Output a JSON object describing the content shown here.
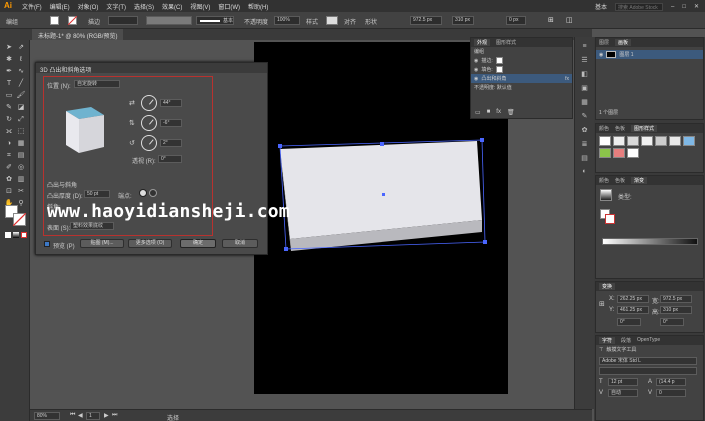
{
  "app": {
    "logo": "Ai"
  },
  "menubar": {
    "items": [
      "文件(F)",
      "编辑(E)",
      "对象(O)",
      "文字(T)",
      "选择(S)",
      "效果(C)",
      "视图(V)",
      "窗口(W)",
      "帮助(H)"
    ],
    "workspace": "基本",
    "search_placeholder": "搜索 Adobe Stock"
  },
  "control": {
    "label": "编组",
    "stroke_label": "描边",
    "style_label": "基本",
    "opacity_label": "不透明度",
    "opacity_value": "100%",
    "style2_label": "样式",
    "align_label": "对齐",
    "shape_label": "形状",
    "x_value": "972.5 px",
    "w_value": "310 px",
    "h_value": "0 px"
  },
  "document": {
    "tab": "未标题-1* @ 80% (RGB/预览)"
  },
  "dialog": {
    "title": "3D 凸出和斜角选项",
    "position_label": "位置 (N):",
    "position_value": "自定旋转",
    "x_angle": "44°",
    "y_angle": "-6°",
    "z_angle": "2°",
    "perspective_label": "透视 (R):",
    "perspective_value": "0°",
    "extrude_section": "凸出与斜角",
    "extrude_depth_label": "凸出厚度 (D):",
    "extrude_depth_value": "50 pt",
    "cap_label": "端点:",
    "bevel_label": "斜角:",
    "surface_label": "表面 (S):",
    "surface_value": "塑料效果底纹",
    "preview_label": "预览 (P)",
    "map_button": "贴图 (M)...",
    "more_button": "更多选项 (O)",
    "ok_button": "确定",
    "cancel_button": "取消"
  },
  "appearance": {
    "tabs": [
      "外观",
      "图形样式"
    ],
    "title": "编组",
    "rows": [
      "描边:",
      "填色:",
      "凸出和斜角"
    ],
    "footer": "不透明度: 默认值"
  },
  "layers": {
    "tabs": [
      "图层",
      "画板"
    ],
    "row": "图层 1",
    "footer": "1 个图层"
  },
  "libraries": {
    "tabs": [
      "颜色",
      "色板",
      "图形样式"
    ]
  },
  "color": {
    "tabs": [
      "颜色",
      "色板",
      "渐变"
    ],
    "grad_label": "类型:"
  },
  "transform": {
    "tabs": [
      "变换"
    ],
    "x_label": "X:",
    "x_value": "262.25 px",
    "y_label": "Y:",
    "y_value": "461.25 px",
    "w_label": "宽:",
    "w_value": "972.5 px",
    "h_label": "高:",
    "h_value": "310 px",
    "angle_value": "0°",
    "shear_value": "0°"
  },
  "character": {
    "tabs": [
      "字符",
      "段落",
      "OpenType"
    ],
    "touch_label": "触摸文字工具",
    "font": "Adobe 宋体 Std L",
    "size": "12 pt",
    "leading": "(14.4 p",
    "tracking_label": "自动",
    "kerning": "0"
  },
  "status": {
    "zoom": "80%",
    "page": "1",
    "tool": "选择"
  },
  "watermark": "www.haoyidiansheji.com",
  "colors": {
    "accent": "#ff9a00",
    "dialog_highlight": "#b8322f",
    "cube_top": "#6fb3cf",
    "selection": "#4a66ff"
  }
}
